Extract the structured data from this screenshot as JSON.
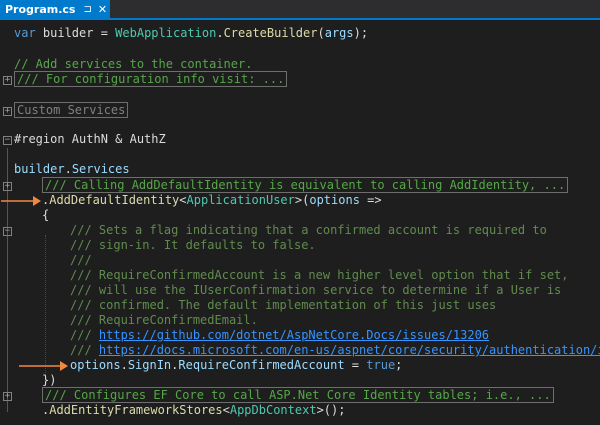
{
  "tab": {
    "title": "Program.cs",
    "pin_icon": "⊐",
    "close_icon": "✕"
  },
  "colors": {
    "accent": "#007acc",
    "keyword": "#569cd6",
    "type": "#4ec9b0",
    "method": "#dcdcaa",
    "comment": "#57a64a",
    "link": "#3794ff",
    "arrow": "#f0883e"
  },
  "code": {
    "l1": {
      "a": "var",
      "b": " builder = ",
      "c": "WebApplication",
      "d": ".",
      "e": "CreateBuilder",
      "f": "(",
      "g": "args",
      "h": ");"
    },
    "l2": "// Add services to the container.",
    "l3": "/// For configuration info visit: ...",
    "l4": "Custom Services",
    "l5": "#region AuthN & AuthZ",
    "l6": {
      "a": "builder",
      "b": ".",
      "c": "Services"
    },
    "l7": "/// Calling AddDefaultIdentity is equivalent to calling AddIdentity, ...",
    "l8": {
      "a": ".",
      "b": "AddDefaultIdentity",
      "c": "<",
      "d": "ApplicationUser",
      "e": ">(",
      "f": "options",
      "g": " =>"
    },
    "l9": "{",
    "doc": [
      "/// Sets a flag indicating that a confirmed account is required to",
      "/// sign-in. It defaults to false.",
      "///",
      "/// RequireConfirmedAccount is a new higher level option that if set,",
      "/// will use the IUserConfirmation service to determine if a User is",
      "/// confirmed. The default implementation of this just uses",
      "/// RequireConfirmedEmail."
    ],
    "link1": "https://github.com/dotnet/AspNetCore.Docs/issues/13206",
    "link2": "https://docs.microsoft.com/en-us/aspnet/core/security/authentication/identity",
    "doc_prefix": "/// ",
    "l18": {
      "a": "options",
      "b": ".",
      "c": "SignIn",
      "d": ".",
      "e": "RequireConfirmedAccount",
      "f": " = ",
      "g": "true",
      "h": ";"
    },
    "l19": "})",
    "l20": "/// Configures EF Core to call ASP.Net Core Identity tables; i.e., ...",
    "l21": {
      "a": ".",
      "b": "AddEntityFrameworkStores",
      "c": "<",
      "d": "AppDbContext",
      "e": ">();"
    }
  }
}
